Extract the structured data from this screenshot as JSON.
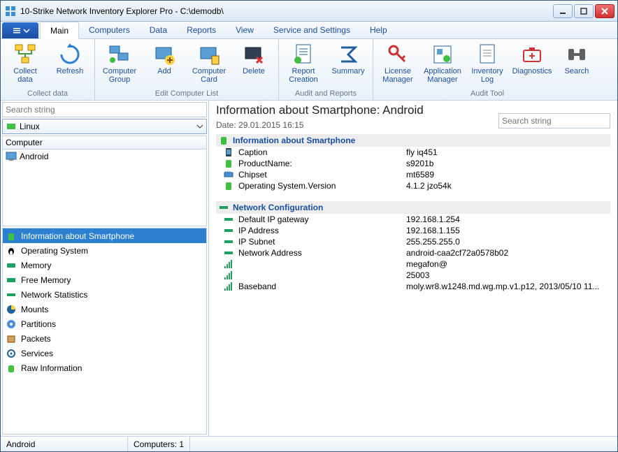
{
  "window": {
    "title": "10-Strike Network Inventory Explorer Pro - C:\\demodb\\"
  },
  "tabs": {
    "file": "☰",
    "main": "Main",
    "computers": "Computers",
    "data": "Data",
    "reports": "Reports",
    "view": "View",
    "service": "Service and Settings",
    "help": "Help"
  },
  "ribbon": {
    "collect": {
      "collect": "Collect\ndata",
      "refresh": "Refresh",
      "label": "Collect data"
    },
    "edit": {
      "group": "Computer\nGroup",
      "add": "Add",
      "card": "Computer\nCard",
      "delete": "Delete",
      "label": "Edit Computer List"
    },
    "audit": {
      "report": "Report\nCreation",
      "summary": "Summary",
      "label": "Audit and Reports"
    },
    "tool": {
      "license": "License\nManager",
      "app": "Application\nManager",
      "inv": "Inventory\nLog",
      "diag": "Diagnostics",
      "search": "Search",
      "label": "Audit Tool"
    }
  },
  "left": {
    "search_ph": "Search string",
    "combo": "Linux",
    "gridhead": "Computer",
    "tree_item": "Android",
    "cats": [
      "Information about Smartphone",
      "Operating System",
      "Memory",
      "Free Memory",
      "Network Statistics",
      "Mounts",
      "Partitions",
      "Packets",
      "Services",
      "Raw Information"
    ]
  },
  "right": {
    "title": "Information about Smartphone: Android",
    "date": "Date: 29.01.2015 16:15",
    "search_ph": "Search string",
    "sec1": {
      "head": "Information about Smartphone",
      "rows": [
        {
          "k": "Caption",
          "v": "fly iq451"
        },
        {
          "k": "ProductName:",
          "v": "s9201b"
        },
        {
          "k": "Chipset",
          "v": "mt6589"
        },
        {
          "k": "Operating System.Version",
          "v": "4.1.2 jzo54k"
        }
      ]
    },
    "sec2": {
      "head": "Network Configuration",
      "rows": [
        {
          "k": "Default IP gateway",
          "v": "192.168.1.254"
        },
        {
          "k": "IP Address",
          "v": "192.168.1.155"
        },
        {
          "k": "IP Subnet",
          "v": "255.255.255.0"
        },
        {
          "k": "Network Address",
          "v": "android-caa2cf72a0578b02"
        },
        {
          "k": "",
          "v": "megafon@"
        },
        {
          "k": "",
          "v": "25003"
        },
        {
          "k": "Baseband",
          "v": "moly.wr8.w1248.md.wg.mp.v1.p12, 2013/05/10 11..."
        }
      ]
    }
  },
  "status": {
    "left": "Android",
    "right": "Computers: 1"
  }
}
